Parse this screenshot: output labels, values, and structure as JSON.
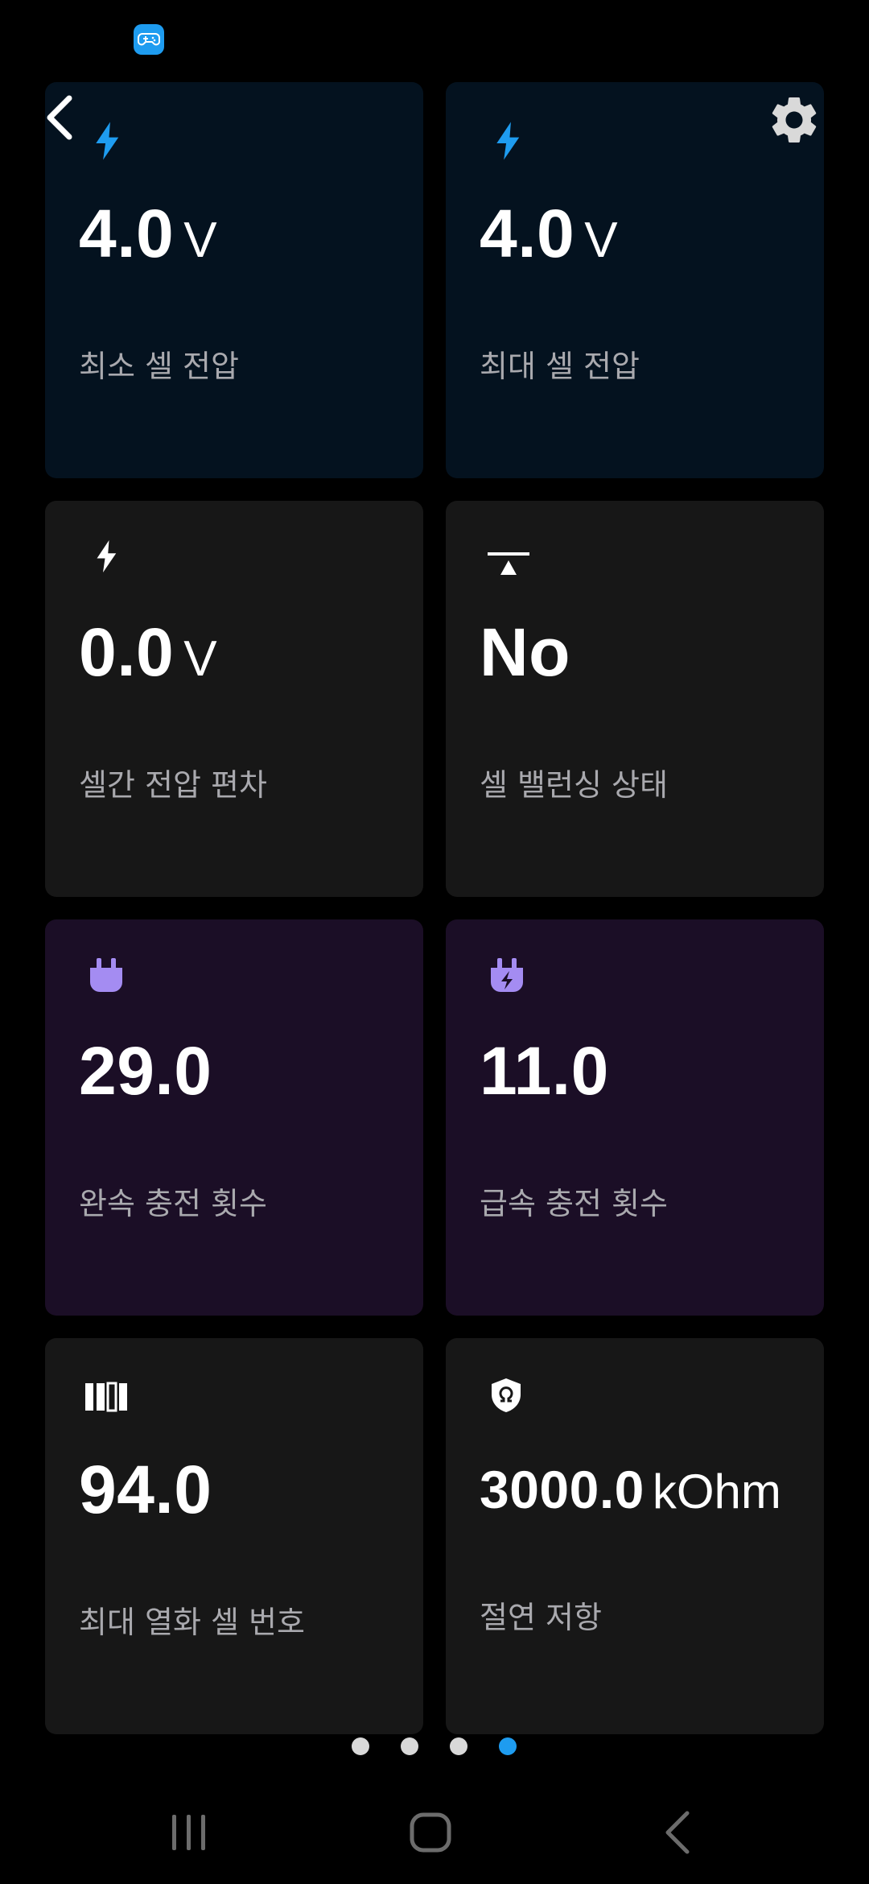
{
  "colors": {
    "background": "#000000",
    "card_blue": "#04121f",
    "card_gray": "#171717",
    "card_purple": "#1b0e26",
    "icon_blue": "#1e9cf0",
    "icon_purple": "#a48cf2",
    "label_gray": "#a9a9ae",
    "dot_active": "#1e9cf0",
    "dot_inactive": "#d9d9d9"
  },
  "status_bar": {
    "app_icon": "game-controller-icon"
  },
  "header": {
    "back_icon": "chevron-left-icon",
    "settings_icon": "gear-icon"
  },
  "cards": [
    {
      "id": "min-cell-voltage",
      "icon": "lightning-bolt-icon",
      "value": "4.0",
      "unit": "V",
      "label": "최소 셀 전압"
    },
    {
      "id": "max-cell-voltage",
      "icon": "lightning-bolt-icon",
      "value": "4.0",
      "unit": "V",
      "label": "최대 셀 전압"
    },
    {
      "id": "cell-voltage-deviation",
      "icon": "lightning-bolt-icon",
      "value": "0.0",
      "unit": "V",
      "label": "셀간 전압 편차"
    },
    {
      "id": "cell-balancing-status",
      "icon": "balance-icon",
      "value": "No",
      "unit": "",
      "label": "셀 밸런싱 상태"
    },
    {
      "id": "slow-charge-count",
      "icon": "plug-icon",
      "value": "29.0",
      "unit": "",
      "label": "완속 충전 횟수"
    },
    {
      "id": "fast-charge-count",
      "icon": "fast-charge-plug-icon",
      "value": "11.0",
      "unit": "",
      "label": "급속 충전 횟수"
    },
    {
      "id": "max-degraded-cell-number",
      "icon": "battery-cells-icon",
      "value": "94.0",
      "unit": "",
      "label": "최대 열화 셀 번호"
    },
    {
      "id": "insulation-resistance",
      "icon": "ohm-shield-icon",
      "value": "3000.0",
      "unit": "kOhm",
      "label": "절연 저항"
    }
  ],
  "pager": {
    "total": 4,
    "active_index": 3
  },
  "nav_bar": {
    "items": [
      "recent-apps-icon",
      "home-icon",
      "back-icon"
    ]
  }
}
